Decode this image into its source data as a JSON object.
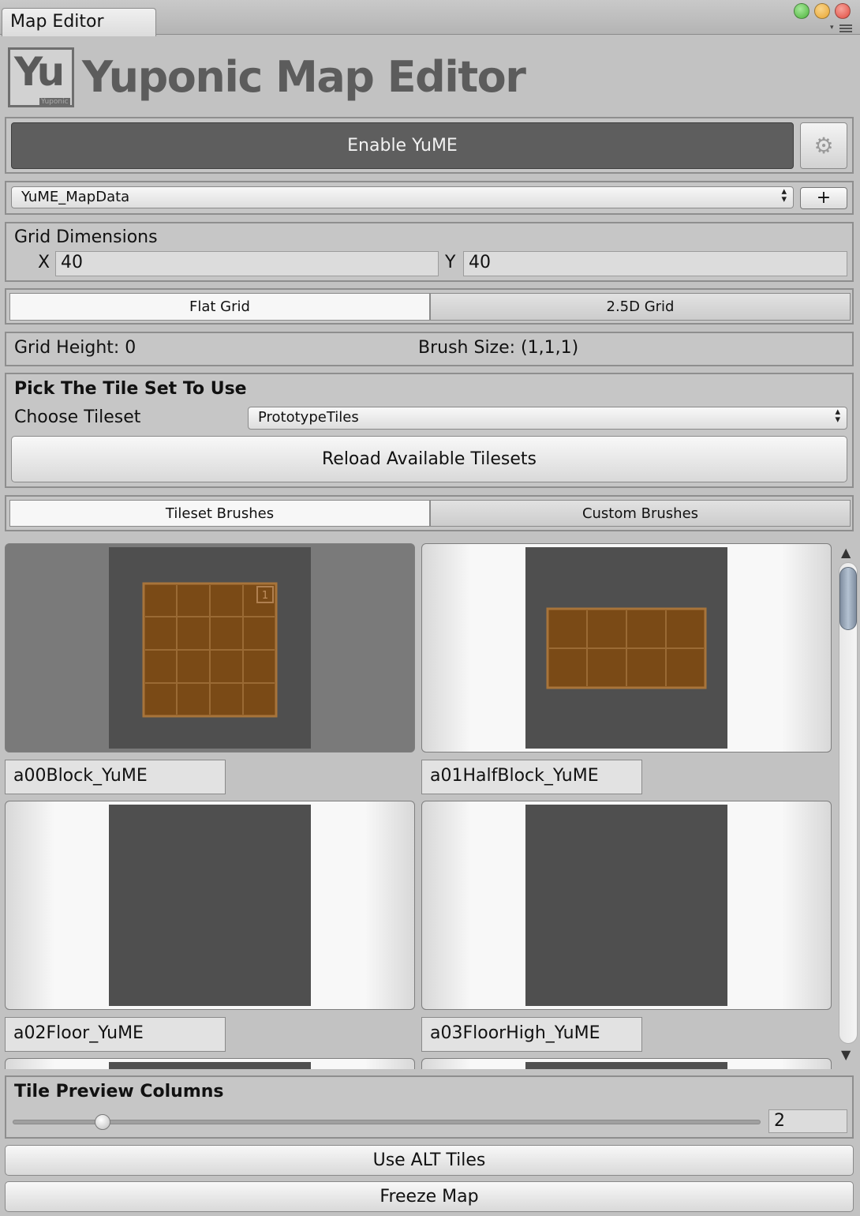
{
  "window": {
    "tab_title": "Map Editor",
    "traffic_lights": [
      {
        "name": "zoom",
        "color": "#4cb33a"
      },
      {
        "name": "minimize",
        "color": "#e9a531"
      },
      {
        "name": "close",
        "color": "#e14a3f"
      }
    ],
    "menu_icon": "list-menu-icon"
  },
  "header": {
    "logo_text": "Yu",
    "logo_subtext": "Yuponic",
    "title": "Yuponic Map Editor"
  },
  "enable": {
    "button_label": "Enable YuME",
    "settings_icon": "gear-icon",
    "button_color": "#5e5e5e"
  },
  "map_data": {
    "selected": "YuME_MapData",
    "add_label": "+"
  },
  "grid_dimensions": {
    "title": "Grid Dimensions",
    "x_label": "X",
    "x_value": "40",
    "y_label": "Y",
    "y_value": "40"
  },
  "grid_mode": {
    "options": [
      "Flat Grid",
      "2.5D Grid"
    ],
    "selected": "Flat Grid"
  },
  "status": {
    "grid_height": "Grid Height: 0",
    "brush_size": "Brush Size: (1,1,1)"
  },
  "tileset": {
    "section_title": "Pick The Tile Set To Use",
    "choose_label": "Choose Tileset",
    "selected": "PrototypeTiles",
    "reload_label": "Reload Available Tilesets"
  },
  "brush_tabs": {
    "options": [
      "Tileset Brushes",
      "Custom Brushes"
    ],
    "selected": "Tileset Brushes"
  },
  "tiles": [
    {
      "name": "a00Block_YuME",
      "selected": true,
      "tile_color": "#7a4a16"
    },
    {
      "name": "a01HalfBlock_YuME",
      "selected": false,
      "tile_color": "#7a4a16"
    },
    {
      "name": "a02Floor_YuME",
      "selected": false
    },
    {
      "name": "a03FloorHigh_YuME",
      "selected": false
    }
  ],
  "preview_columns": {
    "title": "Tile Preview Columns",
    "value": "2",
    "slider_fraction": 0.12
  },
  "buttons": {
    "alt_tiles": "Use ALT Tiles",
    "freeze_map": "Freeze Map"
  }
}
